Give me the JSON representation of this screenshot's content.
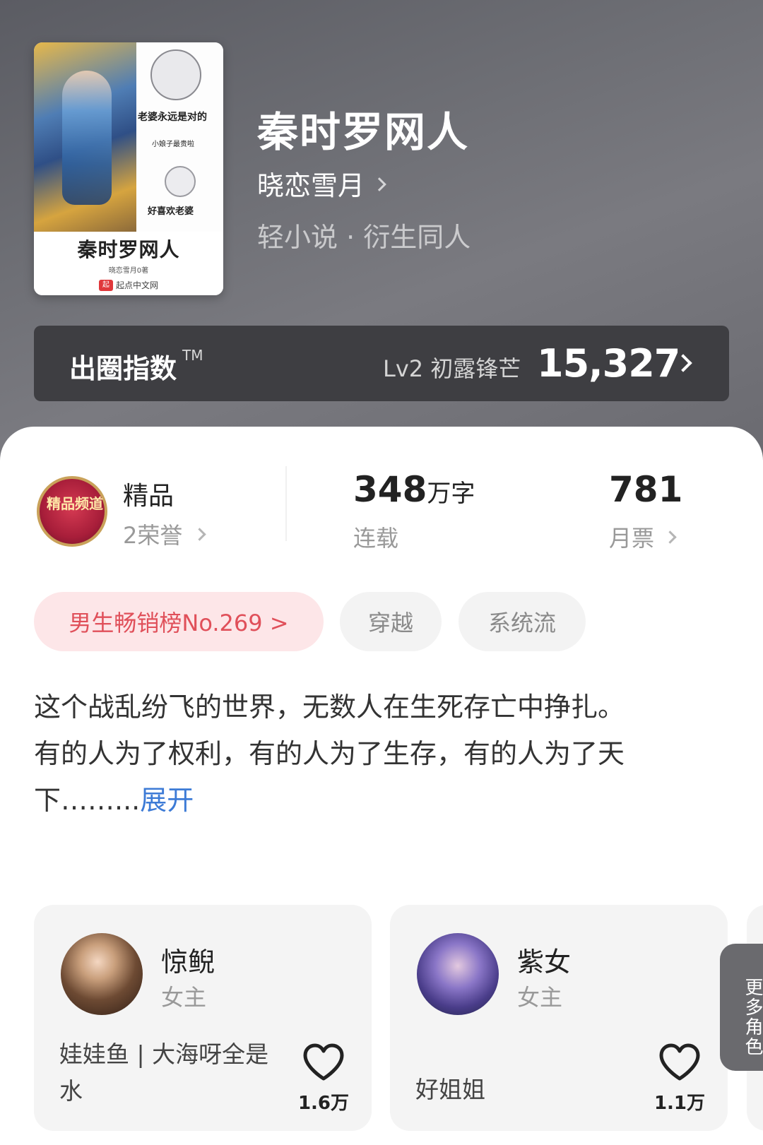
{
  "book": {
    "title": "秦时罗网人",
    "author": "晓恋雪月",
    "genre": "轻小说 · 衍生同人",
    "cover": {
      "side_text_1": "老婆永远是对的",
      "side_text_2": "小娘子最贵啦",
      "side_text_3": "好喜欢老婆",
      "title": "秦时罗网人",
      "author_line": "晓恋雪月0著",
      "publisher": "起点中文网",
      "publisher_logo": "起"
    }
  },
  "influence_index": {
    "label": "出圈指数",
    "tm": "TM",
    "level": "Lv2 初露锋芒",
    "score": "15,327"
  },
  "stats": {
    "honor": {
      "badge_text": "精品频道",
      "title": "精品",
      "subtitle": "2荣誉"
    },
    "words": {
      "number": "348",
      "unit": "万字",
      "subtitle": "连载"
    },
    "votes": {
      "number": "781",
      "subtitle": "月票"
    }
  },
  "tags": {
    "rank": "男生畅销榜No.269 >",
    "items": [
      "穿越",
      "系统流"
    ]
  },
  "description": {
    "line1": "这个战乱纷飞的世界，无数人在生死存亡中挣扎。",
    "line2": "有的人为了权利，有的人为了生存，有的人为了天下……...",
    "expand": "展开"
  },
  "roles": [
    {
      "name": "惊鲵",
      "type": "女主",
      "desc": "娃娃鱼 | 大海呀全是水",
      "likes": "1.6万"
    },
    {
      "name": "紫女",
      "type": "女主",
      "desc": "好姐姐",
      "likes": "1.1万"
    }
  ],
  "more_roles": "更多角色",
  "colors": {
    "accent_blue": "#3d7bd6",
    "rank_red": "#e0505a",
    "rank_bg": "#fde6e8"
  }
}
